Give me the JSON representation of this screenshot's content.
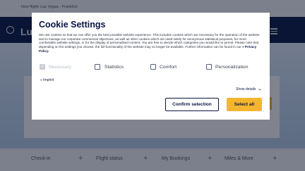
{
  "notice": {
    "line1": "New flight: Las Vegas - Frankfurt",
    "line2": ""
  },
  "header": {
    "logo_text": "Lu"
  },
  "bottom_nav": {
    "items": [
      {
        "label": "Check-in"
      },
      {
        "label": "Flight status"
      },
      {
        "label": "My Bookings"
      },
      {
        "label": "Miles & More"
      }
    ],
    "plus": "+"
  },
  "cookie_modal": {
    "title": "Cookie Settings",
    "body": "We use cookies so that we can offer you the best possible website experience. This includes cookies which are necessary for the operation of the website and to manage our corporate commercial objectives, as well as other cookies which are used solely for anonymous statistical purposes, for more comfortable website settings, or for the display of personalised content. You are free to decide which categories you would like to permit. Please note that depending on the settings you choose, the full functionality of the website may no longer be available. Further information can be found in our",
    "privacy_link": "Privacy Policy.",
    "options": [
      {
        "label": "Necessary",
        "checked": true,
        "disabled": true
      },
      {
        "label": "Statistics",
        "checked": false,
        "disabled": false
      },
      {
        "label": "Comfort",
        "checked": false,
        "disabled": false
      },
      {
        "label": "Personalization",
        "checked": false,
        "disabled": false
      }
    ],
    "imprint": "Imprint",
    "show_details": "Show details",
    "confirm_label": "Confirm selection",
    "select_all_label": "Select all"
  },
  "colors": {
    "brand_navy": "#0a1643",
    "accent_yellow": "#f5b62f"
  }
}
